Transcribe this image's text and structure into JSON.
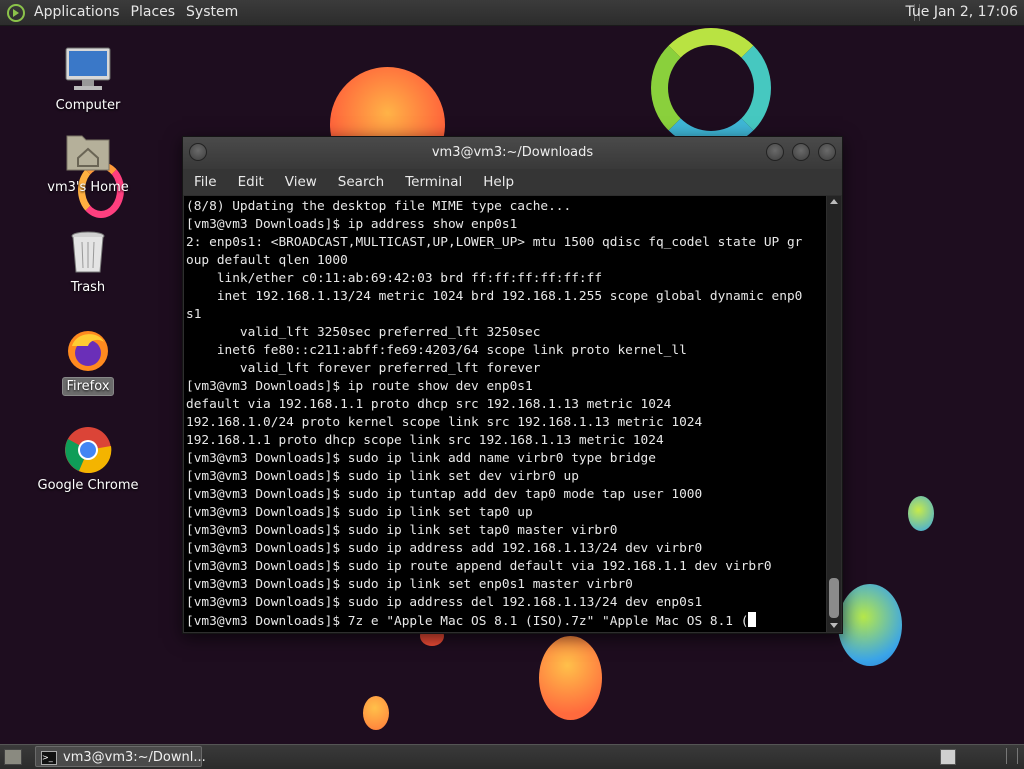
{
  "top_panel": {
    "menus": [
      "Applications",
      "Places",
      "System"
    ],
    "clock": "Tue Jan  2, 17:06"
  },
  "desktop": {
    "icons": [
      {
        "label": "Computer",
        "icon": "computer-icon"
      },
      {
        "label": "vm3's Home",
        "icon": "home-folder-icon"
      },
      {
        "label": "Trash",
        "icon": "trash-icon"
      },
      {
        "label": "Firefox",
        "icon": "firefox-icon",
        "selected": true
      },
      {
        "label": "Google Chrome",
        "icon": "chrome-icon"
      }
    ]
  },
  "window": {
    "title": "vm3@vm3:~/Downloads",
    "menus": [
      "File",
      "Edit",
      "View",
      "Search",
      "Terminal",
      "Help"
    ],
    "terminal_lines": [
      "(8/8) Updating the desktop file MIME type cache...",
      "[vm3@vm3 Downloads]$ ip address show enp0s1",
      "2: enp0s1: <BROADCAST,MULTICAST,UP,LOWER_UP> mtu 1500 qdisc fq_codel state UP gr",
      "oup default qlen 1000",
      "    link/ether c0:11:ab:69:42:03 brd ff:ff:ff:ff:ff:ff",
      "    inet 192.168.1.13/24 metric 1024 brd 192.168.1.255 scope global dynamic enp0",
      "s1",
      "       valid_lft 3250sec preferred_lft 3250sec",
      "    inet6 fe80::c211:abff:fe69:4203/64 scope link proto kernel_ll",
      "       valid_lft forever preferred_lft forever",
      "[vm3@vm3 Downloads]$ ip route show dev enp0s1",
      "default via 192.168.1.1 proto dhcp src 192.168.1.13 metric 1024",
      "192.168.1.0/24 proto kernel scope link src 192.168.1.13 metric 1024",
      "192.168.1.1 proto dhcp scope link src 192.168.1.13 metric 1024",
      "[vm3@vm3 Downloads]$ sudo ip link add name virbr0 type bridge",
      "[vm3@vm3 Downloads]$ sudo ip link set dev virbr0 up",
      "[vm3@vm3 Downloads]$ sudo ip tuntap add dev tap0 mode tap user 1000",
      "[vm3@vm3 Downloads]$ sudo ip link set tap0 up",
      "[vm3@vm3 Downloads]$ sudo ip link set tap0 master virbr0",
      "[vm3@vm3 Downloads]$ sudo ip address add 192.168.1.13/24 dev virbr0",
      "[vm3@vm3 Downloads]$ sudo ip route append default via 192.168.1.1 dev virbr0",
      "[vm3@vm3 Downloads]$ sudo ip link set enp0s1 master virbr0",
      "[vm3@vm3 Downloads]$ sudo ip address del 192.168.1.13/24 dev enp0s1"
    ],
    "current_prompt": "[vm3@vm3 Downloads]$ 7z e \"Apple Mac OS 8.1 (ISO).7z\" \"Apple Mac OS 8.1 ("
  },
  "bottom_panel": {
    "task_label": "vm3@vm3:~/Downl..."
  },
  "colors": {
    "wallpaper": "#1e0d1f",
    "terminal_bg": "#000000",
    "terminal_fg": "#e8e8e8",
    "panel": "#333333"
  }
}
